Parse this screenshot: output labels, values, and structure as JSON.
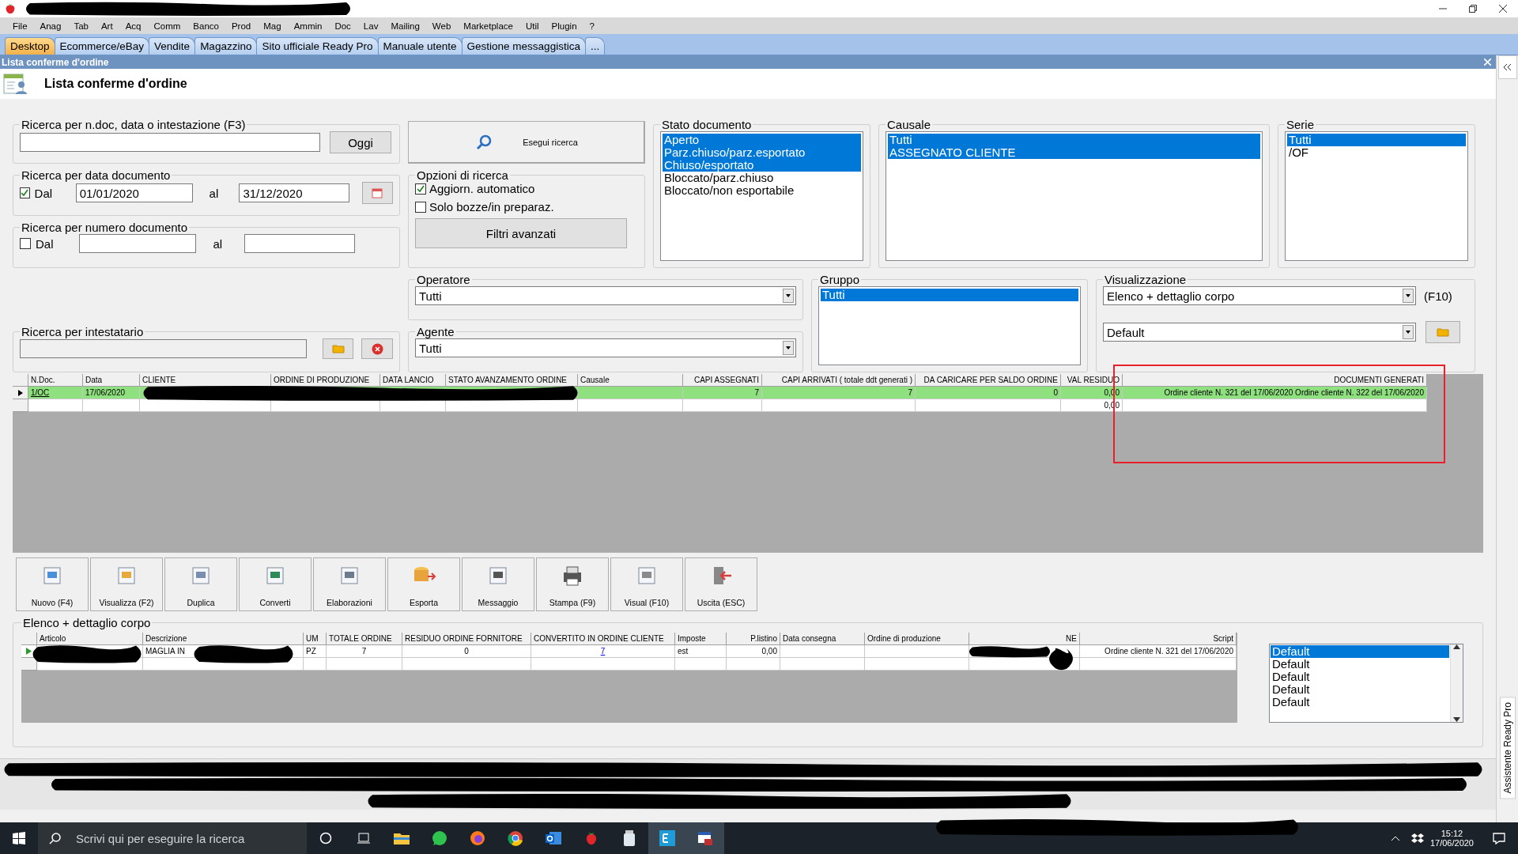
{
  "menu": [
    "File",
    "Anag",
    "Tab",
    "Art",
    "Acq",
    "Comm",
    "Banco",
    "Prod",
    "Mag",
    "Ammin",
    "Doc",
    "Lav",
    "Mailing",
    "Web",
    "Marketplace",
    "Util",
    "Plugin",
    "?"
  ],
  "tabs": [
    {
      "label": "Desktop",
      "selected": true
    },
    {
      "label": "Ecommerce/eBay",
      "selected": false
    },
    {
      "label": "Vendite",
      "selected": false
    },
    {
      "label": "Magazzino",
      "selected": false
    },
    {
      "label": "Sito ufficiale Ready Pro",
      "selected": false
    },
    {
      "label": "Manuale utente",
      "selected": false
    },
    {
      "label": "Gestione messaggistica",
      "selected": false
    },
    {
      "label": "...",
      "selected": false
    }
  ],
  "child_window": {
    "title": "Lista conferme d'ordine",
    "heading": "Lista conferme d'ordine"
  },
  "filters": {
    "quick_search": {
      "label": "Ricerca per n.doc, data o intestazione (F3)",
      "button": "Oggi"
    },
    "date_search": {
      "label": "Ricerca per data documento",
      "from_label": "Dal",
      "checked": true,
      "from": "01/01/2020",
      "to_label": "al",
      "to": "31/12/2020"
    },
    "number_search": {
      "label": "Ricerca per numero documento",
      "from_label": "Dal",
      "checked": false,
      "to_label": "al"
    },
    "holder_search": {
      "label": "Ricerca per intestatario"
    },
    "run_button": "Esegui ricerca",
    "options": {
      "label": "Opzioni di ricerca",
      "items": [
        {
          "label": "Aggiorn. automatico",
          "checked": true
        },
        {
          "label": "Solo bozze/in preparaz.",
          "checked": false
        }
      ],
      "button": "Filtri avanzati"
    },
    "status": {
      "label": "Stato documento",
      "items": [
        {
          "label": "Aperto",
          "selected": true
        },
        {
          "label": "Parz.chiuso/parz.esportato",
          "selected": true
        },
        {
          "label": "Chiuso/esportato",
          "selected": true
        },
        {
          "label": "Bloccato/parz.chiuso",
          "selected": false
        },
        {
          "label": "Bloccato/non esportabile",
          "selected": false
        }
      ]
    },
    "reason": {
      "label": "Causale",
      "items": [
        {
          "label": "Tutti",
          "selected": true
        },
        {
          "label": "ASSEGNATO CLIENTE",
          "selected": true
        }
      ]
    },
    "series": {
      "label": "Serie",
      "items": [
        {
          "label": "Tutti",
          "selected": true
        },
        {
          "label": "/OF",
          "selected": false
        }
      ]
    },
    "operator": {
      "label": "Operatore",
      "value": "Tutti"
    },
    "agent": {
      "label": "Agente",
      "value": "Tutti"
    },
    "group": {
      "label": "Gruppo",
      "items": [
        {
          "label": "Tutti",
          "selected": true
        }
      ]
    },
    "view": {
      "label": "Visualizzazione",
      "value": "Elenco + dettaglio corpo",
      "hint": "(F10)",
      "layout": "Default"
    }
  },
  "results": {
    "columns": [
      "N.Doc.",
      "Data",
      "CLIENTE",
      "ORDINE DI PRODUZIONE",
      "DATA LANCIO",
      "STATO AVANZAMENTO ORDINE",
      "Causale",
      "CAPI ASSEGNATI",
      "CAPI ARRIVATI ( totale ddt generati )",
      "DA CARICARE PER SALDO ORDINE",
      "VAL RESIDUO",
      "DOCUMENTI GENERATI"
    ],
    "rows": [
      {
        "selected": true,
        "cells": [
          "1/OC",
          "17/06/2020",
          null,
          null,
          null,
          null,
          null,
          "7",
          "7",
          "0",
          "0,00",
          "Ordine cliente N. 321 del 17/06/2020   Ordine cliente N. 322 del 17/06/2020"
        ]
      },
      {
        "selected": false,
        "cells": [
          null,
          null,
          null,
          null,
          null,
          null,
          null,
          null,
          null,
          null,
          "0,00",
          null
        ]
      }
    ]
  },
  "toolbar": [
    "Nuovo (F4)",
    "Visualizza (F2)",
    "Duplica",
    "Converti",
    "Elaborazioni",
    "Esporta",
    "Messaggio",
    "Stampa (F9)",
    "Visual (F10)",
    "Uscita (ESC)"
  ],
  "detail": {
    "label": "Elenco + dettaglio corpo",
    "columns": [
      "Articolo",
      "Descrizione",
      "UM",
      "TOTALE ORDINE",
      "RESIDUO ORDINE FORNITORE",
      "CONVERTITO IN ORDINE CLIENTE",
      "Imposte",
      "P.listino",
      "Data consegna",
      "Ordine di produzione",
      "NE",
      "Script"
    ],
    "rows": [
      {
        "selected": true,
        "cells": [
          null,
          "MAGLIA IN",
          "PZ",
          "7",
          "0",
          "7",
          "est",
          "0,00",
          null,
          null,
          null,
          "Ordine cliente N. 321 del 17/06/2020"
        ]
      }
    ],
    "layouts": [
      {
        "label": "Default",
        "selected": true
      },
      {
        "label": "Default",
        "selected": false
      },
      {
        "label": "Default",
        "selected": false
      },
      {
        "label": "Default",
        "selected": false
      },
      {
        "label": "Default",
        "selected": false
      }
    ]
  },
  "side_panel": {
    "label": "Assistente Ready Pro"
  },
  "taskbar": {
    "search_placeholder": "Scrivi qui per eseguire la ricerca",
    "time": "15:12",
    "date": "17/06/2020"
  }
}
